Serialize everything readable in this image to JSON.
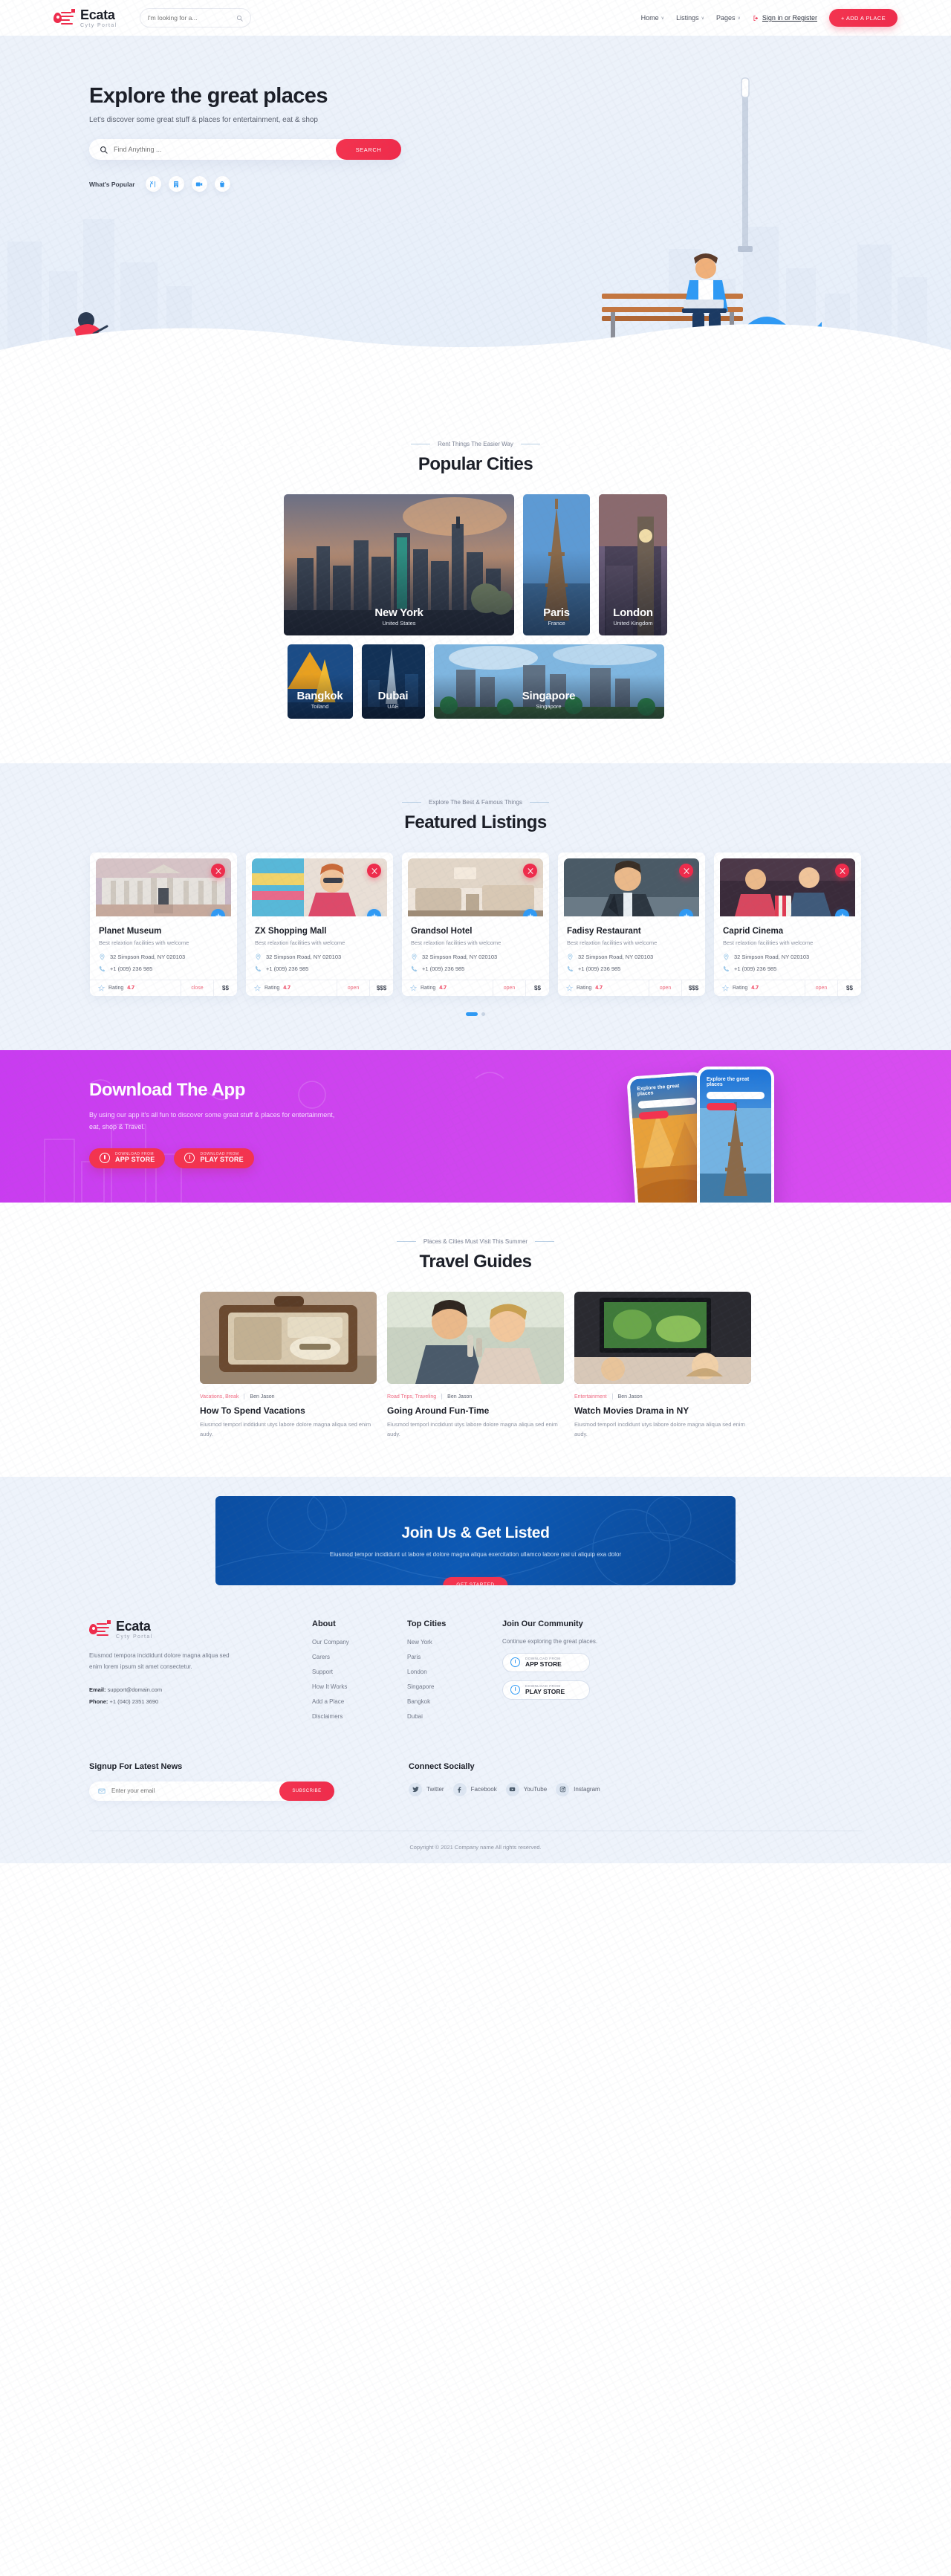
{
  "header": {
    "brand_name": "Ecata",
    "brand_tagline": "Cyty Portal",
    "search_placeholder": "I'm looking for a...",
    "search_value": "",
    "nav": [
      {
        "label": "Home",
        "caret": "∨"
      },
      {
        "label": "Listings",
        "caret": "∨"
      },
      {
        "label": "Pages",
        "caret": "∨"
      }
    ],
    "signin_label": "Sign in or Register",
    "add_place_label": "+ ADD A PLACE"
  },
  "hero": {
    "title": "Explore the great places",
    "subtitle": "Let's discover some great stuff & places for entertainment, eat & shop",
    "search_placeholder": "Find Anything ...",
    "search_value": "",
    "search_button": "SEARCH",
    "popular_label": "What's Popular",
    "categories": [
      {
        "name": "restaurant-icon"
      },
      {
        "name": "hotel-icon"
      },
      {
        "name": "cinema-icon"
      },
      {
        "name": "shopping-icon"
      }
    ]
  },
  "cities": {
    "eyebrow": "Rent Things The Easier Way",
    "title": "Popular Cities",
    "row1": [
      {
        "name": "New York",
        "country": "United States"
      },
      {
        "name": "Paris",
        "country": "France"
      },
      {
        "name": "London",
        "country": "United Kingdom"
      }
    ],
    "row2": [
      {
        "name": "Bangkok",
        "country": "Toiland"
      },
      {
        "name": "Dubai",
        "country": "UAE"
      },
      {
        "name": "Singapore",
        "country": "Singapore"
      }
    ]
  },
  "featured": {
    "eyebrow": "Explore The Best & Famous Things",
    "title": "Featured Listings",
    "cards": [
      {
        "title": "Planet Museum",
        "desc": "Best relaxtion facilities with welcome",
        "address": "32 Simpson Road, NY 020103",
        "phone": "+1 (009) 236 985",
        "rating_label": "Rating",
        "rating": "4.7",
        "status": "close",
        "price": "$$"
      },
      {
        "title": "ZX Shopping Mall",
        "desc": "Best relaxtion facilities with welcome",
        "address": "32 Simpson Road, NY 020103",
        "phone": "+1 (009) 236 985",
        "rating_label": "Rating",
        "rating": "4.7",
        "status": "open",
        "price": "$$$"
      },
      {
        "title": "Grandsol Hotel",
        "desc": "Best relaxtion facilities with welcome",
        "address": "32 Simpson Road, NY 020103",
        "phone": "+1 (009) 236 985",
        "rating_label": "Rating",
        "rating": "4.7",
        "status": "open",
        "price": "$$"
      },
      {
        "title": "Fadisy Restaurant",
        "desc": "Best relaxtion facilities with welcome",
        "address": "32 Simpson Road, NY 020103",
        "phone": "+1 (009) 236 985",
        "rating_label": "Rating",
        "rating": "4.7",
        "status": "open",
        "price": "$$$"
      },
      {
        "title": "Caprid Cinema",
        "desc": "Best relaxtion facilities with welcome",
        "address": "32 Simpson Road, NY 020103",
        "phone": "+1 (009) 236 985",
        "rating_label": "Rating",
        "rating": "4.7",
        "status": "open",
        "price": "$$"
      }
    ]
  },
  "download": {
    "title": "Download The App",
    "desc": "By using our app it's all fun to discover some great stuff & places for entertainment, eat, shop & Travel.",
    "buttons": [
      {
        "small": "DOWNLOAD FROM",
        "big": "APP STORE"
      },
      {
        "small": "DOWNLOAD FROM",
        "big": "PLAY STORE"
      }
    ],
    "phone1_title": "Explore the great places",
    "phone2_title": "Explore the great places"
  },
  "guides": {
    "eyebrow": "Places & Cities Must Visit This Summer",
    "title": "Travel Guides",
    "cards": [
      {
        "category": "Vacations, Break",
        "author": "Ben Jason",
        "title": "How To Spend Vacations",
        "desc": "Eiusmod temporl inddidunt utys labore dolore magna aliqua sed enim audy."
      },
      {
        "category": "Road Trips, Traveling",
        "author": "Ben Jason",
        "title": "Going Around Fun-Time",
        "desc": "Eiusmod temporl incdidunt utys labore dolore magna aliqua sed enim audy."
      },
      {
        "category": "Entertainment",
        "author": "Ben Jason",
        "title": "Watch Movies Drama in NY",
        "desc": "Eiusmod temporl incdidunt utys labore dolore magna aliqua sed enim audy."
      }
    ]
  },
  "join": {
    "title": "Join Us & Get Listed",
    "desc": "Eiusmod tempor incididunt ut labore et dolore magna aliqua exercitation ullamco labore nisi ut aliquip exa dolor",
    "button": "GET STARTED"
  },
  "footer": {
    "brand_name": "Ecata",
    "brand_tagline": "Cyty Portal",
    "desc": "Eiusmod tempora incididunt dolore magna aliqua sed enim lorem ipsum sit amet consectetur.",
    "email_label": "Email:",
    "email": "support@domain.com",
    "phone_label": "Phone:",
    "phone": "+1 (040) 2351 3690",
    "columns": [
      {
        "title": "About",
        "items": [
          "Our Company",
          "Carers",
          "Support",
          "How It Works",
          "Add a Place",
          "Disclaimers"
        ]
      },
      {
        "title": "Top Cities",
        "items": [
          "New York",
          "Paris",
          "London",
          "Singapore",
          "Bangkok",
          "Dubai"
        ]
      }
    ],
    "community": {
      "title": "Join Our Community",
      "desc": "Continue exploring the great places.",
      "buttons": [
        {
          "small": "DOWNLOAD FROM",
          "big": "APP STORE"
        },
        {
          "small": "DOWNLOAD FROM",
          "big": "PLAY STORE"
        }
      ]
    },
    "signup_title": "Signup For Latest News",
    "signup_placeholder": "Enter your email",
    "signup_value": "",
    "subscribe_label": "SUBSCRIBE",
    "social_title": "Connect Socially",
    "socials": [
      {
        "label": "Twitter",
        "icon": "twitter-icon"
      },
      {
        "label": "Facebook",
        "icon": "facebook-icon"
      },
      {
        "label": "YouTube",
        "icon": "youtube-icon"
      },
      {
        "label": "Instagram",
        "icon": "instagram-icon"
      }
    ],
    "copyright": "Copyright © 2021 Company name All rights reserved."
  },
  "colors": {
    "accent": "#ef2b4b",
    "blue": "#2f9af5",
    "purple": "#cf45ef",
    "deep_blue": "#0b4ea2",
    "bg": "#eef3fb"
  }
}
